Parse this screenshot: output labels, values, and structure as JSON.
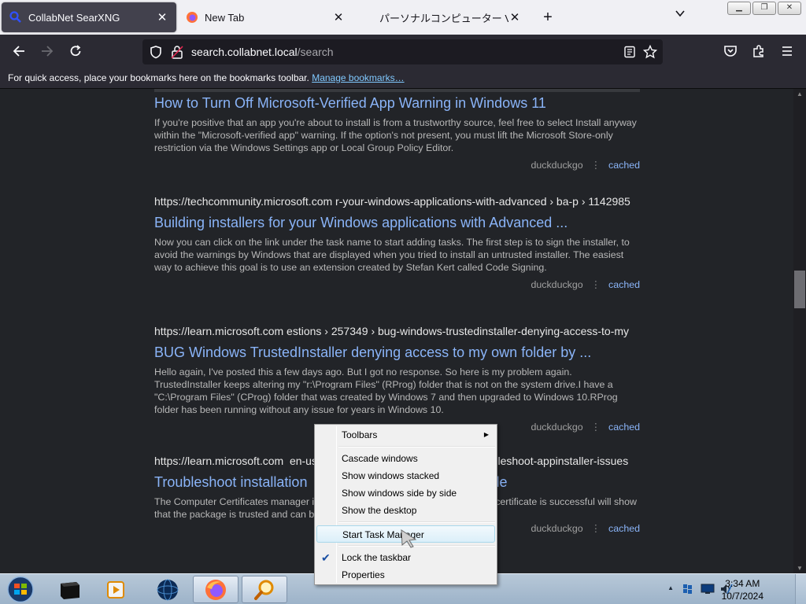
{
  "tabs": [
    {
      "label": "CollabNet SearXNG",
      "active": true,
      "icon": "searxng-icon"
    },
    {
      "label": "New Tab",
      "active": false,
      "icon": "firefox-icon"
    },
    {
      "label": "パーソナルコンピューター VAIO",
      "active": false,
      "icon": "none"
    }
  ],
  "nav": {
    "url_host": "search.collabnet.local",
    "url_path": "/search"
  },
  "bookmarks": {
    "message": "For quick access, place your bookmarks here on the bookmarks toolbar.",
    "manage_link": "Manage bookmarks…"
  },
  "results": [
    {
      "url": "",
      "title": "How to Turn Off Microsoft-Verified App Warning in Windows 11",
      "description": "If you're positive that an app you're about to install is from a trustworthy source, feel free to select Install anyway within the \"Microsoft-verified app\" warning. If the option's not present, you must lift the Microsoft Store-only restriction via the Windows Settings app or Local Group Policy Editor.",
      "engine": "duckduckgo",
      "cached": "cached"
    },
    {
      "url": "https://techcommunity.microsoft.com ​r-your-windows-applications-with-advanced › ba-p › 1142985",
      "title": "Building installers for your Windows applications with Advanced ...",
      "description": "Now you can click on the link under the task name to start adding tasks. The first step is to sign the installer, to avoid the warnings by Windows that are displayed when you tried to install an untrusted installer. The easiest way to achieve this goal is to use an extension created by Stefan Kert called Code Signing.",
      "engine": "duckduckgo",
      "cached": "cached"
    },
    {
      "url": "https://learn.microsoft.com  estions › 257349 › bug-windows-trustedinstaller-denying-access-to-my",
      "title": "BUG Windows TrustedInstaller denying access to my own folder by ...",
      "description": "Hello again, I've posted this a few days ago. But I got no response. So here is my problem again. TrustedInstaller keeps altering my \"r:\\Program Files\" (RProg) folder that is not on the system drive.I have a \"C:\\Program Files\" (CProg) folder that was created by Windows 7 and then upgraded to Windows 10.RProg folder has been running without any issue for years in Windows 10.",
      "engine": "duckduckgo",
      "cached": "cached"
    },
    {
      "url": "https://learn.microsoft.com  en-us                                                       ubleshoot-appinstaller-issues",
      "title": "Troubleshoot installation                                          er file",
      "description": "The Computer Certificates manager                                          ing from the Start Menu: Once the signing certificate is successful                                          will show that the package is trusted and can be installed:",
      "engine": "duckduckgo",
      "cached": "cached"
    }
  ],
  "context_menu": {
    "toolbars": "Toolbars",
    "cascade": "Cascade windows",
    "stacked": "Show windows stacked",
    "side_by_side": "Show windows side by side",
    "show_desktop": "Show the desktop",
    "task_manager": "Start Task Manager",
    "lock": "Lock the taskbar",
    "properties": "Properties"
  },
  "clock": {
    "time": "3:34 AM",
    "date": "10/7/2024"
  },
  "colors": {
    "accent_link": "#8ab4f8",
    "page_bg": "#222428"
  }
}
